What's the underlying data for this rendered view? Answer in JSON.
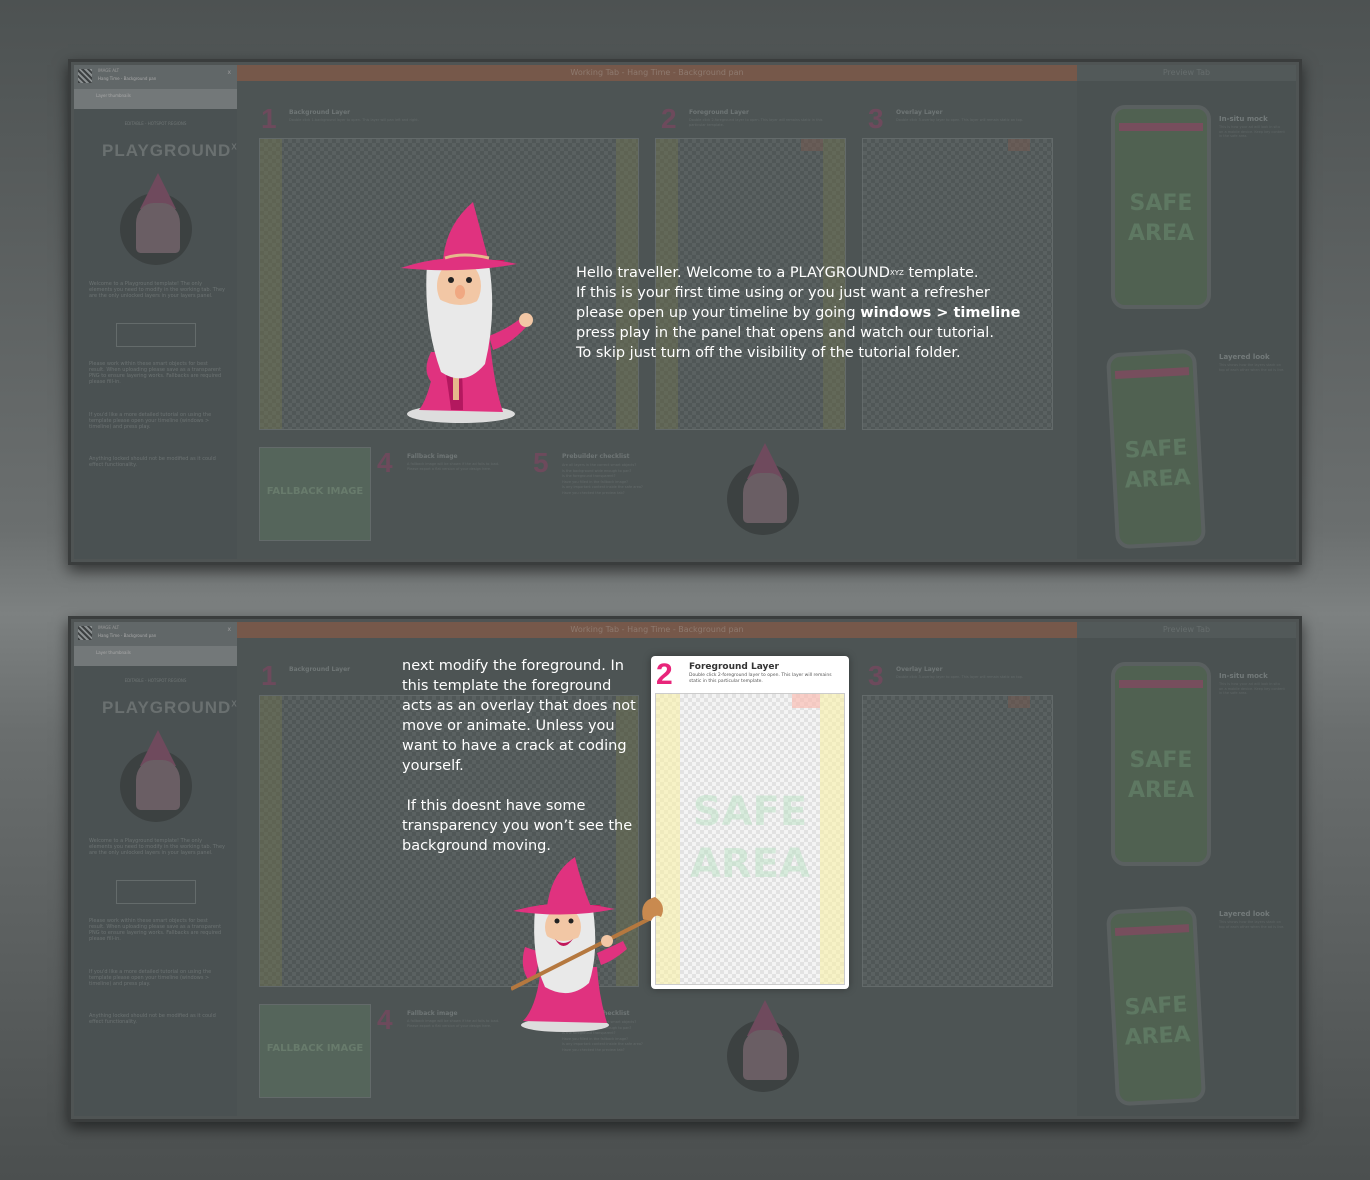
{
  "window": {
    "title_small": "IMAGE ALT",
    "title": "Hang Time - Background pan",
    "subtitle": "Layer thumbnails",
    "close_glyph": "x"
  },
  "tabs": {
    "working": "Working Tab - Hang Time - Background pan",
    "preview": "Preview Tab"
  },
  "sidebar": {
    "header": "EDITABLE - HOTSPOT REGIONS",
    "logo": "PLAYGROUND",
    "logo_sup": "XYZ",
    "para1": "Welcome to a Playground template! The only elements you need to modify in the working tab. They are the only unlocked layers in your layers panel.",
    "para2": "Please work within these smart objects for best result. When uploading please save as a transparent PNG to ensure layering works. Fallbacks are required please fill-in.",
    "para3": "If you'd like a more detailed tutorial on using the template please open your timeline (windows > timeline) and press play.",
    "para4": "Anything locked should not be modified as it could effect functionality."
  },
  "sections": {
    "s1": {
      "num": "1",
      "title": "Background Layer",
      "sub": "Double click 1-background layer to open. This layer will pan left and right."
    },
    "s2": {
      "num": "2",
      "title": "Foreground Layer",
      "sub": "Double click 2-foreground layer to open. This layer will remains static in this particular template."
    },
    "s3": {
      "num": "3",
      "title": "Overlay Layer",
      "sub": "Double click 3-overlay layer to open. This layer will remain static on top."
    },
    "s4": {
      "num": "4",
      "title": "Fallback image",
      "sub": "A fallback image will be shown if the ad fails to load. Please export a flat version of your design here."
    },
    "s5": {
      "num": "5",
      "title": "Prebuilder checklist"
    }
  },
  "fallback_text": "FALLBACK IMAGE",
  "checklist": [
    "Are all layers in the correct smart objects?",
    "Is the background wide enough to pan?",
    "Is the foreground transparent?",
    "Have you filled in the fallback image?",
    "Is any important content inside the safe area?",
    "Have you checked the preview tab?"
  ],
  "preview": {
    "insitu_title": "In-situ mock",
    "insitu_text": "This is how your ad will look in situ on a mobile device. Keep key content in the safe area.",
    "layered_title": "Layered look",
    "layered_text": "This shows how the layers stack on top of each other when the ad is live.",
    "safe_area": "SAFE AREA",
    "phone_bar": "PLAYGROUND"
  },
  "tutorial1": {
    "line1_pre": "Hello traveller. Welcome to a PLAYGROUND",
    "line1_sup": "XYZ",
    "line1_post": "  template.",
    "line2": "If this is your first time using or you just want a refresher",
    "line3_pre": "please open up your timeline by going ",
    "line3_bold": "windows > timeline",
    "line4": "press play in the panel that opens and watch our tutorial.",
    "line5": "To skip just turn off the visibility of the tutorial folder."
  },
  "tutorial2": {
    "para1": "next modify the foreground. In this template the foreground acts as an overlay that does not move or animate. Unless you want to have a crack at coding yourself.",
    "para2": " If this doesnt have some transparency you won’t see the background moving."
  },
  "highlight": {
    "num": "2",
    "title": "Foreground Layer",
    "sub": "Double click 2-foreground layer to open. This layer will remains static in this particular template.",
    "safe_area": "SAFE AREA"
  },
  "colors": {
    "accent_pink": "#e8257a",
    "wizard_pink": "#e0327f",
    "overlay_dim": "#4f5454"
  }
}
